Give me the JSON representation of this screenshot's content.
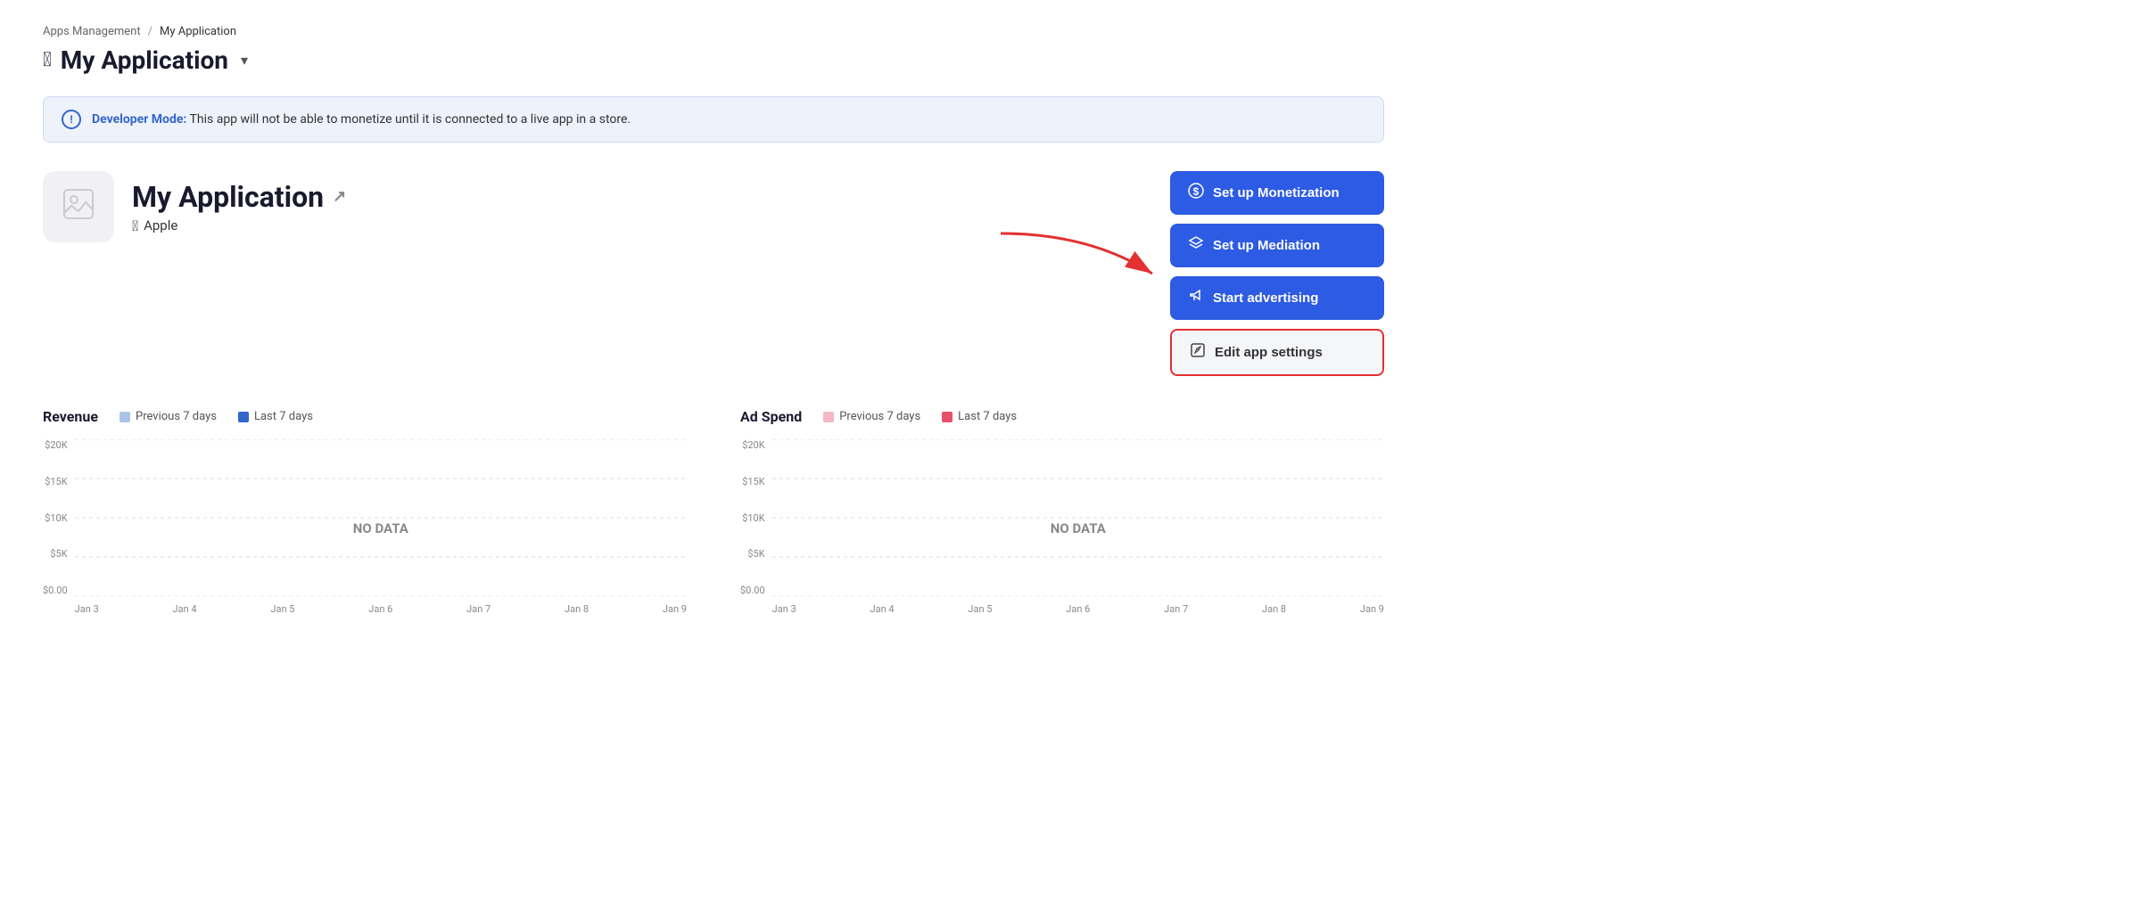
{
  "breadcrumb": {
    "parent_label": "Apps Management",
    "separator": "/",
    "current_label": "My Application"
  },
  "page_title": {
    "icon": "🍎",
    "text": "My Application",
    "chevron": "▾"
  },
  "banner": {
    "icon_label": "!",
    "bold_text": "Developer Mode:",
    "body_text": " This app will not be able to monetize until it is connected to a live app in a store."
  },
  "app": {
    "name": "My Application",
    "platform": "Apple",
    "external_link_icon": "↗"
  },
  "buttons": {
    "monetization": "Set up Monetization",
    "mediation": "Set up Mediation",
    "advertising": "Start advertising",
    "edit_settings": "Edit app settings"
  },
  "revenue_chart": {
    "title": "Revenue",
    "legend_prev": "Previous 7 days",
    "legend_last": "Last 7 days",
    "y_labels": [
      "$20K",
      "$15K",
      "$10K",
      "$5K",
      "$0.00"
    ],
    "x_labels": [
      "Jan 3",
      "Jan 4",
      "Jan 5",
      "Jan 6",
      "Jan 7",
      "Jan 8",
      "Jan 9"
    ],
    "no_data": "NO DATA"
  },
  "adspend_chart": {
    "title": "Ad Spend",
    "legend_prev": "Previous 7 days",
    "legend_last": "Last 7 days",
    "y_labels": [
      "$20K",
      "$15K",
      "$10K",
      "$5K",
      "$0.00"
    ],
    "x_labels": [
      "Jan 3",
      "Jan 4",
      "Jan 5",
      "Jan 6",
      "Jan 7",
      "Jan 8",
      "Jan 9"
    ],
    "no_data": "NO DATA"
  },
  "colors": {
    "blue_button": "#2d5be3",
    "legend_prev_revenue": "#a8c4e8",
    "legend_last_revenue": "#3366cc",
    "legend_prev_adspend": "#f5b8c4",
    "legend_last_adspend": "#e8506a",
    "red_border": "#e33030"
  }
}
